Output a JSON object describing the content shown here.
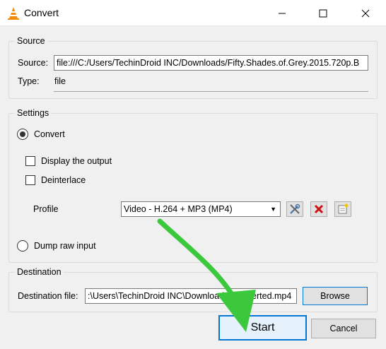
{
  "window": {
    "title": "Convert",
    "icon": "vlc-cone-icon"
  },
  "source_group": {
    "title": "Source",
    "source_label": "Source:",
    "source_value": "file:///C:/Users/TechinDroid INC/Downloads/Fifty.Shades.of.Grey.2015.720p.B",
    "type_label": "Type:",
    "type_value": "file"
  },
  "settings_group": {
    "title": "Settings",
    "convert_label": "Convert",
    "convert_selected": true,
    "display_output_label": "Display the output",
    "deinterlace_label": "Deinterlace",
    "profile_label": "Profile",
    "profile_value": "Video - H.264 + MP3 (MP4)",
    "dump_raw_label": "Dump raw input"
  },
  "destination_group": {
    "title": "Destination",
    "file_label": "Destination file:",
    "file_value": ":\\Users\\TechinDroid INC\\Downloads\\Converted.mp4",
    "browse_label": "Browse"
  },
  "actions": {
    "start_label": "Start",
    "cancel_label": "Cancel"
  },
  "colors": {
    "accent": "#0078d7",
    "annotation_arrow": "#3cc83c"
  }
}
